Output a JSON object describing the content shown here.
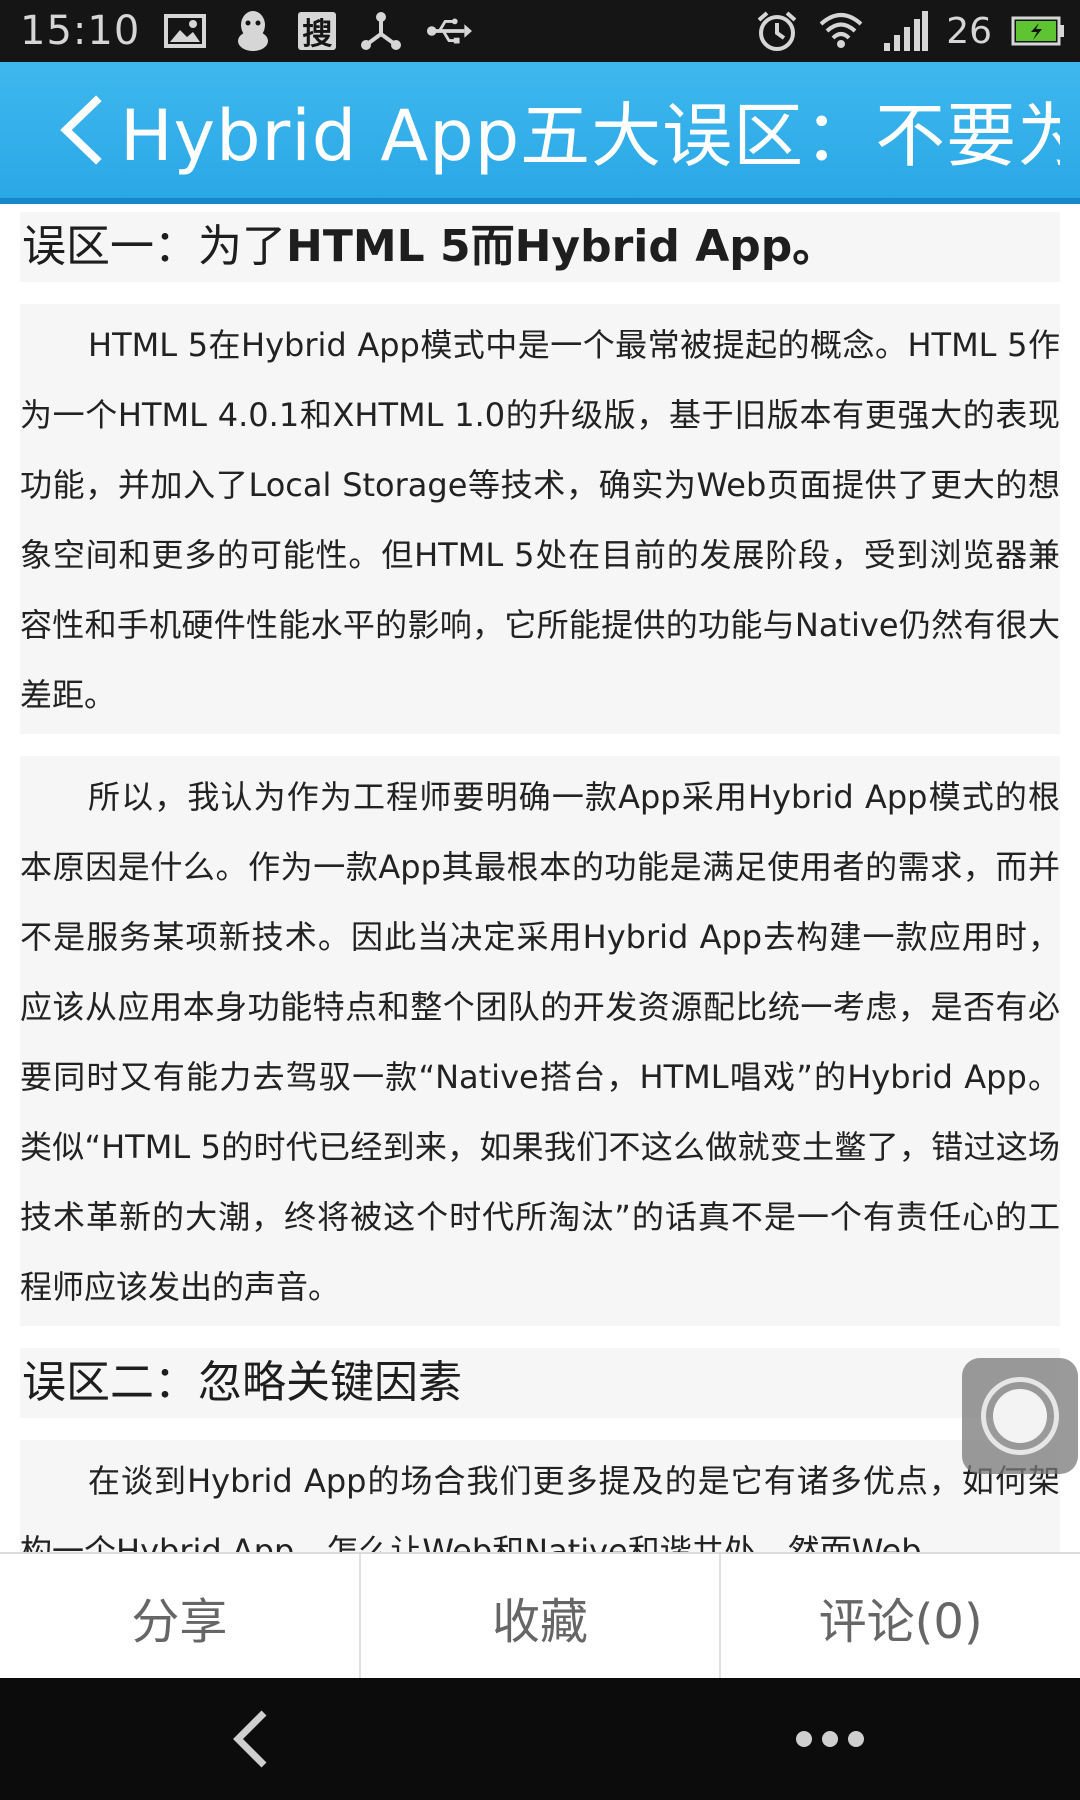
{
  "status_bar": {
    "time": "15:10",
    "search_badge": "搜",
    "battery_level": "26",
    "icons": [
      "image-icon",
      "qq-penguin-icon",
      "sougou-search-icon",
      "network-share-icon",
      "usb-icon",
      "alarm-icon",
      "wifi-icon",
      "signal-icon",
      "battery-charging-icon"
    ]
  },
  "title_bar": {
    "title": "Hybrid App五大误区：不要为..",
    "color": "#2aa8e6"
  },
  "article": {
    "section1_heading_prefix": "误区一：为了",
    "section1_heading_bold": "HTML 5而Hybrid App。",
    "paragraph1": "HTML 5在Hybrid App模式中是一个最常被提起的概念。HTML 5作为一个HTML 4.0.1和XHTML 1.0的升级版，基于旧版本有更强大的表现功能，并加入了Local Storage等技术，确实为Web页面提供了更大的想象空间和更多的可能性。但HTML 5处在目前的发展阶段，受到浏览器兼容性和手机硬件性能水平的影响，它所能提供的功能与Native仍然有很大差距。",
    "paragraph2": "所以，我认为作为工程师要明确一款App采用Hybrid App模式的根本原因是什么。作为一款App其最根本的功能是满足使用者的需求，而并不是服务某项新技术。因此当决定采用Hybrid App去构建一款应用时，应该从应用本身功能特点和整个团队的开发资源配比统一考虑，是否有必要同时又有能力去驾驭一款“Native搭台，HTML唱戏”的Hybrid App。类似“HTML 5的时代已经到来，如果我们不这么做就变土鳖了，错过这场技术革新的大潮，终将被这个时代所淘汰”的话真不是一个有责任心的工程师应该发出的声音。",
    "section2_heading": "误区二：忽略关键因素",
    "paragraph3": "在谈到Hybrid App的场合我们更多提及的是它有诸多优点，如何架构一个Hybrid App，怎么让Web和Native和谐共处，然而Web"
  },
  "action_bar": {
    "share": "分享",
    "favorite": "收藏",
    "comment": "评论(0)"
  }
}
